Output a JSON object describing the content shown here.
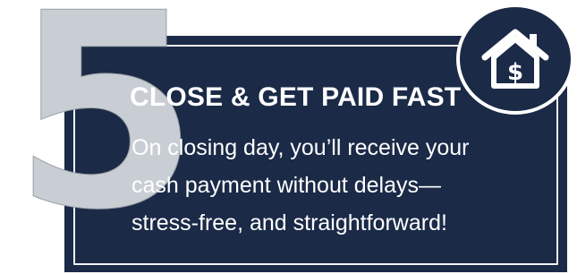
{
  "step": {
    "number": "5"
  },
  "card": {
    "title": "CLOSE & GET PAID FAST",
    "lines": [
      "On closing day, you’ll receive your",
      "cash payment without delays—",
      "stress-free, and straightforward!"
    ]
  },
  "badge": {
    "icon": "house-dollar-icon",
    "symbol": "$"
  },
  "colors": {
    "card_background": "#1b2a47",
    "text": "#ffffff",
    "number": "#c9ced4"
  }
}
